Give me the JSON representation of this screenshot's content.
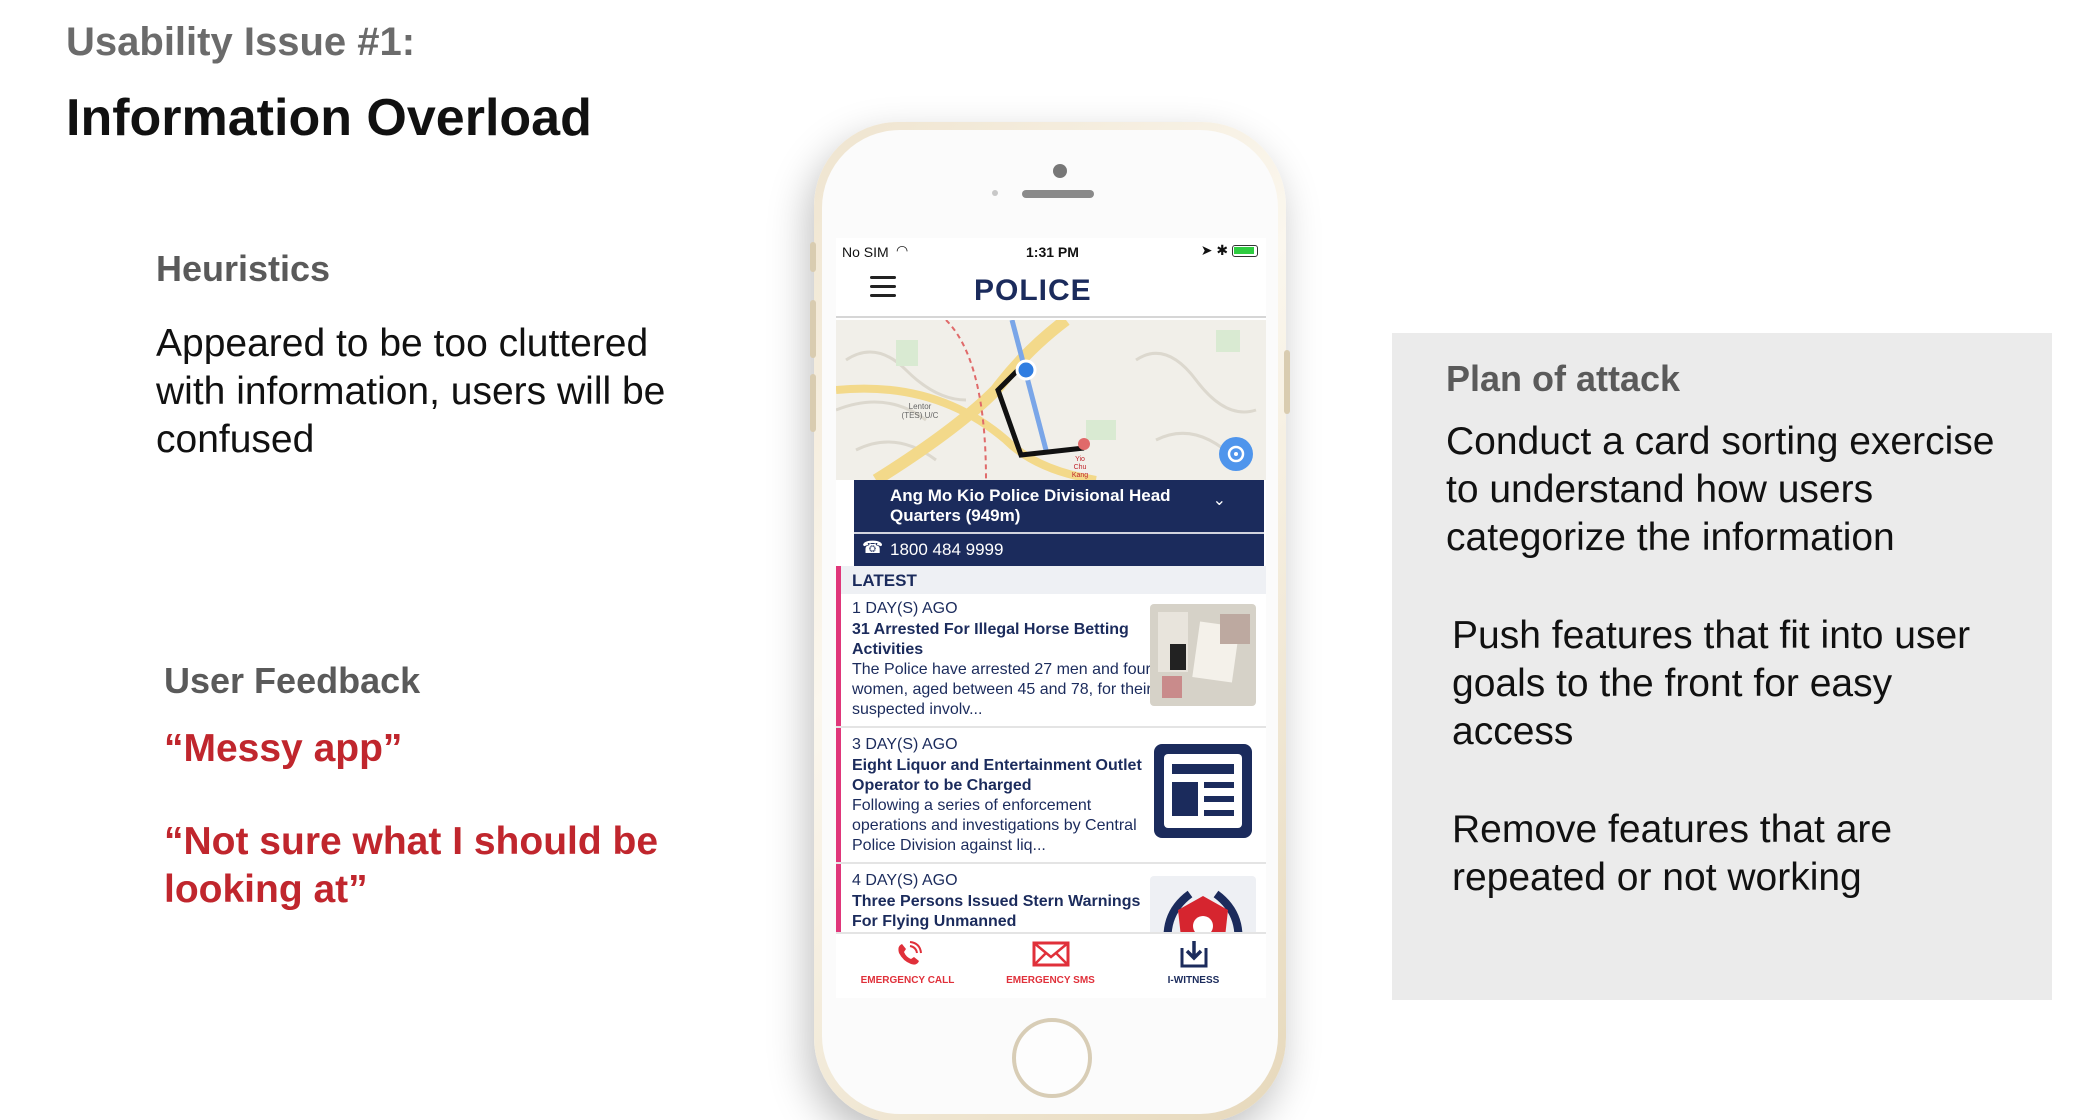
{
  "slide": {
    "kicker": "Usability Issue #1:",
    "title": "Information Overload"
  },
  "heuristics": {
    "label": "Heuristics",
    "text": "Appeared to be too cluttered with information, users will be confused"
  },
  "feedback": {
    "label": "User Feedback",
    "quote1": "“Messy app”",
    "quote2": "“Not sure what I should be looking at”"
  },
  "plan": {
    "label": "Plan of attack",
    "item1": "Conduct a card sorting exercise to understand how users categorize the information",
    "item2": "Push features that fit into user goals to the front for easy access",
    "item3": "Remove features that are repeated or not working"
  },
  "app": {
    "status": {
      "carrier": "No SIM",
      "time": "1:31 PM"
    },
    "brand": "POLICE",
    "map": {
      "place1": "Lentor (TES) U/C",
      "place2": "Yio Chu Kang"
    },
    "station": {
      "name": "Ang Mo Kio Police Divisional Head Quarters (949m)",
      "phone": "1800 484 9999"
    },
    "latest_label": "LATEST",
    "news": [
      {
        "ago": "1 DAY(S) AGO",
        "title": "31 Arrested For Illegal Horse Betting Activities",
        "body": "The Police have arrested 27 men and four women, aged between 45 and 78, for their suspected involv..."
      },
      {
        "ago": "3 DAY(S) AGO",
        "title": "Eight Liquor and Entertainment Outlet Operator to be Charged",
        "body": "Following a series of enforcement operations and investigations by Central Police Division against liq..."
      },
      {
        "ago": "4 DAY(S) AGO",
        "title": "Three Persons Issued Stern Warnings For Flying Unmanned",
        "body": ""
      }
    ],
    "tabs": [
      {
        "label": "EMERGENCY CALL",
        "icon": "phone-icon",
        "color": "#e0303a"
      },
      {
        "label": "EMERGENCY SMS",
        "icon": "envelope-icon",
        "color": "#e0303a"
      },
      {
        "label": "I-WITNESS",
        "icon": "download-icon",
        "color": "#1b2b5c"
      }
    ]
  },
  "colors": {
    "accent_red": "#c0262d",
    "navy": "#1b2b5c",
    "panel_gray": "#ebebeb"
  }
}
